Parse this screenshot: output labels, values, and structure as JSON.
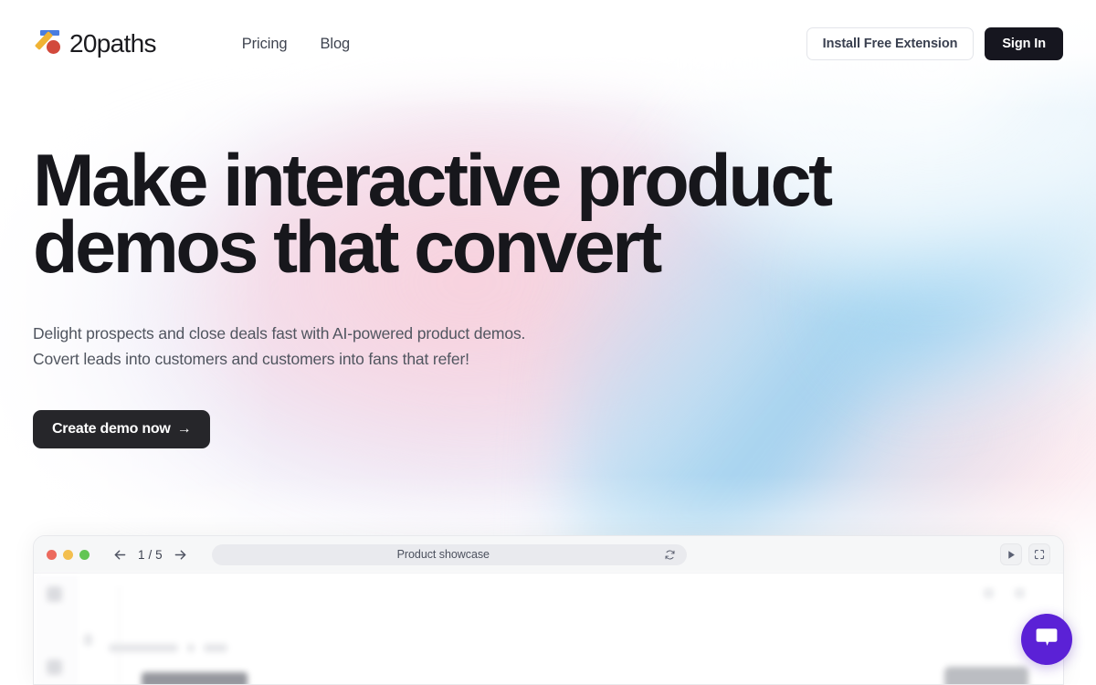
{
  "brand": {
    "name": "20paths",
    "logo_colors": {
      "bar": "#4A7DE0",
      "slash": "#F0B334",
      "dot": "#D2493C"
    }
  },
  "nav": {
    "links": [
      {
        "label": "Pricing"
      },
      {
        "label": "Blog"
      }
    ],
    "install_extension_label": "Install Free Extension",
    "sign_in_label": "Sign In"
  },
  "hero": {
    "heading_line1": "Make interactive product",
    "heading_line2": "demos that convert",
    "sub_line1": "Delight prospects and close deals fast with AI-powered product demos.",
    "sub_line2": "Covert leads into customers and customers into fans that refer!",
    "cta_label": "Create demo now",
    "cta_arrow": "→"
  },
  "demo_window": {
    "page_count": "1 / 5",
    "address_text": "Product showcase",
    "traffic_lights": [
      {
        "color": "#ec6a5e"
      },
      {
        "color": "#f3bf4f"
      },
      {
        "color": "#62c554"
      }
    ]
  },
  "chat": {
    "accent_color": "#5B21D6"
  },
  "theme": {
    "text_dark": "#17171c",
    "text_muted": "#50555f",
    "button_dark": "#26262a",
    "header_dark": "#16161f"
  }
}
